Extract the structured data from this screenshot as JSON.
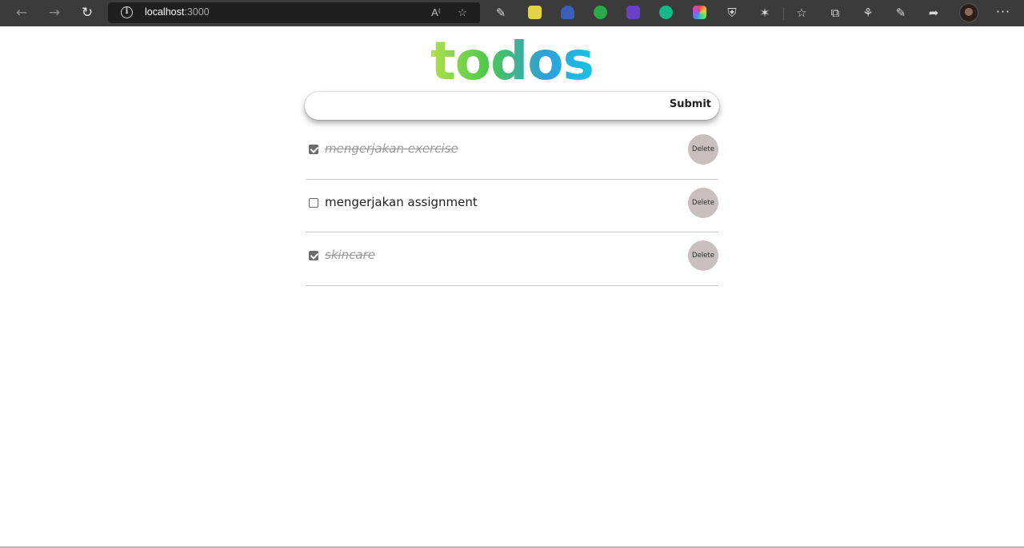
{
  "browser": {
    "url_host": "localhost",
    "url_port": ":3000"
  },
  "app": {
    "title": "todos",
    "input_value": "",
    "submit_label": "Submit",
    "delete_label": "Delete",
    "colors": {
      "gradient_start": "#b5e24a",
      "gradient_end": "#19c4e6",
      "delete_bg": "#c9bfbf"
    }
  },
  "todos": [
    {
      "text": "mengerjakan exercise",
      "completed": true
    },
    {
      "text": "mengerjakan assignment",
      "completed": false
    },
    {
      "text": "skincare",
      "completed": true
    }
  ]
}
